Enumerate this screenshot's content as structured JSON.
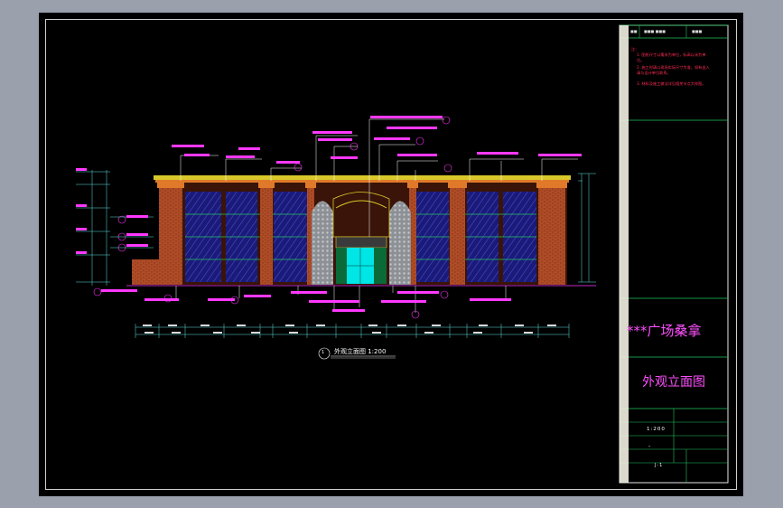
{
  "title_block": {
    "notes_heading": "注：",
    "notes": [
      "1. 图纸尺寸以毫米为单位，标高以米为单位。",
      "2. 施工时请以现场实际尺寸为准，如有出入请与设计单位联系。",
      "3. 材料及施工做法详见相关节点大样图。"
    ],
    "project_name": "***广场桑拿",
    "drawing_name": "外观立面图",
    "scale_value": "1:200",
    "dash_value": "-",
    "sheet_no": "J-1"
  },
  "drawing": {
    "caption": "外观立面图  1:200",
    "caption_marker": "1"
  },
  "colors": {
    "background": "#000000",
    "outer_bg": "#9aa1ac",
    "border": "#e0e0e0",
    "divider_green": "#22c55e",
    "magenta_text": "#ff4fff",
    "notes_red": "#ff2d55",
    "brick": "#c0562c",
    "glass_blue": "#2a2a9a",
    "entrance_cyan": "#00e5e5",
    "ornament": "#9ea3a8",
    "cornice_yellow": "#d8c82a",
    "annotation_magenta": "#ff38ff",
    "dim_cyan": "#60e0e0"
  }
}
